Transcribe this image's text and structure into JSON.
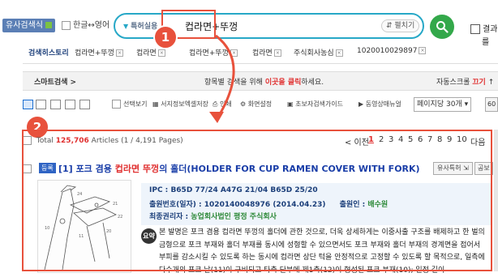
{
  "header": {
    "similar_search_btn": "유사검색식",
    "hanen_label": "한글↔영어",
    "search_type": "특허실용",
    "query": "컵라면+뚜껑",
    "expand_btn": "펼치기",
    "right_checkbox_label": "결과 내",
    "right_checkbox_label2": "를"
  },
  "annotations": {
    "badge1": "1",
    "badge2": "2"
  },
  "history": {
    "label": "검색히스토리",
    "items": [
      "컵라면+뚜껑",
      "컵라면",
      "컵라면+뚜껑",
      "컵라면",
      "주식회사농심",
      "1020010029897"
    ]
  },
  "smart_bar": {
    "label": "스마트검색 >",
    "msg_prefix": "항목별 검색을 위해",
    "msg_highlight": "이곳을 클릭",
    "msg_suffix": "하세요.",
    "auto_scroll_label": "자동스크롤",
    "auto_scroll_state": "끄기"
  },
  "toolbar": {
    "items": [
      "선택보기",
      "서지정보엑셀저장",
      "인쇄",
      "화면설정",
      "초보자검색가이드",
      "동영상매뉴얼"
    ],
    "page_size": "페이지당 30개",
    "page_size_go": "60"
  },
  "results": {
    "total_label": "Total",
    "total_count": "125,706",
    "articles": "Articles (1 / 4,191 Pages)",
    "pager": {
      "prev": "< 이전",
      "current": "1",
      "pages": [
        "2",
        "3",
        "4",
        "5",
        "6",
        "7",
        "8",
        "9",
        "10"
      ],
      "next": "다음"
    }
  },
  "result1": {
    "status": "등록",
    "index": "[1]",
    "title_pre": "포크 겸용",
    "title_hl1": "컵라면",
    "title_hl2": "뚜껑",
    "title_post": "의 홀더(HOLDER FOR CUP RAMEN COVER WITH FORK)",
    "similar_btn": "유사특허",
    "similar_btn2": "공보",
    "ipc_label": "IPC :",
    "ipc_values": "B65D 77/24   A47G 21/04   B65D 25/20",
    "app_label": "출원번호(일자) :",
    "app_value": "1020140048976 (2014.04.23)",
    "applicant_label": "출원인 :",
    "applicant_value": "배수원",
    "right_holder_label": "최종권리자 :",
    "right_holder_value": "농업회사법인 평정 주식회사",
    "summary_badge": "요약",
    "summary_text": "본 발명은 포크 겸용 컵라면 뚜껑의 홀더에 관한 것으로, 더욱 상세하게는 이중사출 구조를 배제하고 한 벌의 금형으로 포크 부재와 홀더 부재를 동시에 성형할 수 있으면서도 포크 부재와 홀더 부재의 경계면을 접어서 부피를 감소시킬 수 있도록 하는 동시에 컵라면 상단 턱을 안정적으로 고정할 수 있도록 할 목적으로, 일측에 다수개의 포크 날(11)이 구비되고 타측 단부에 제1축(12)이 형성된 포크 부재(10); 일정 길이"
  },
  "colors": {
    "accent": "#27a8c7",
    "highlight_red": "#e8513c",
    "go_green": "#33a84a",
    "link_blue": "#1a3ea8"
  }
}
